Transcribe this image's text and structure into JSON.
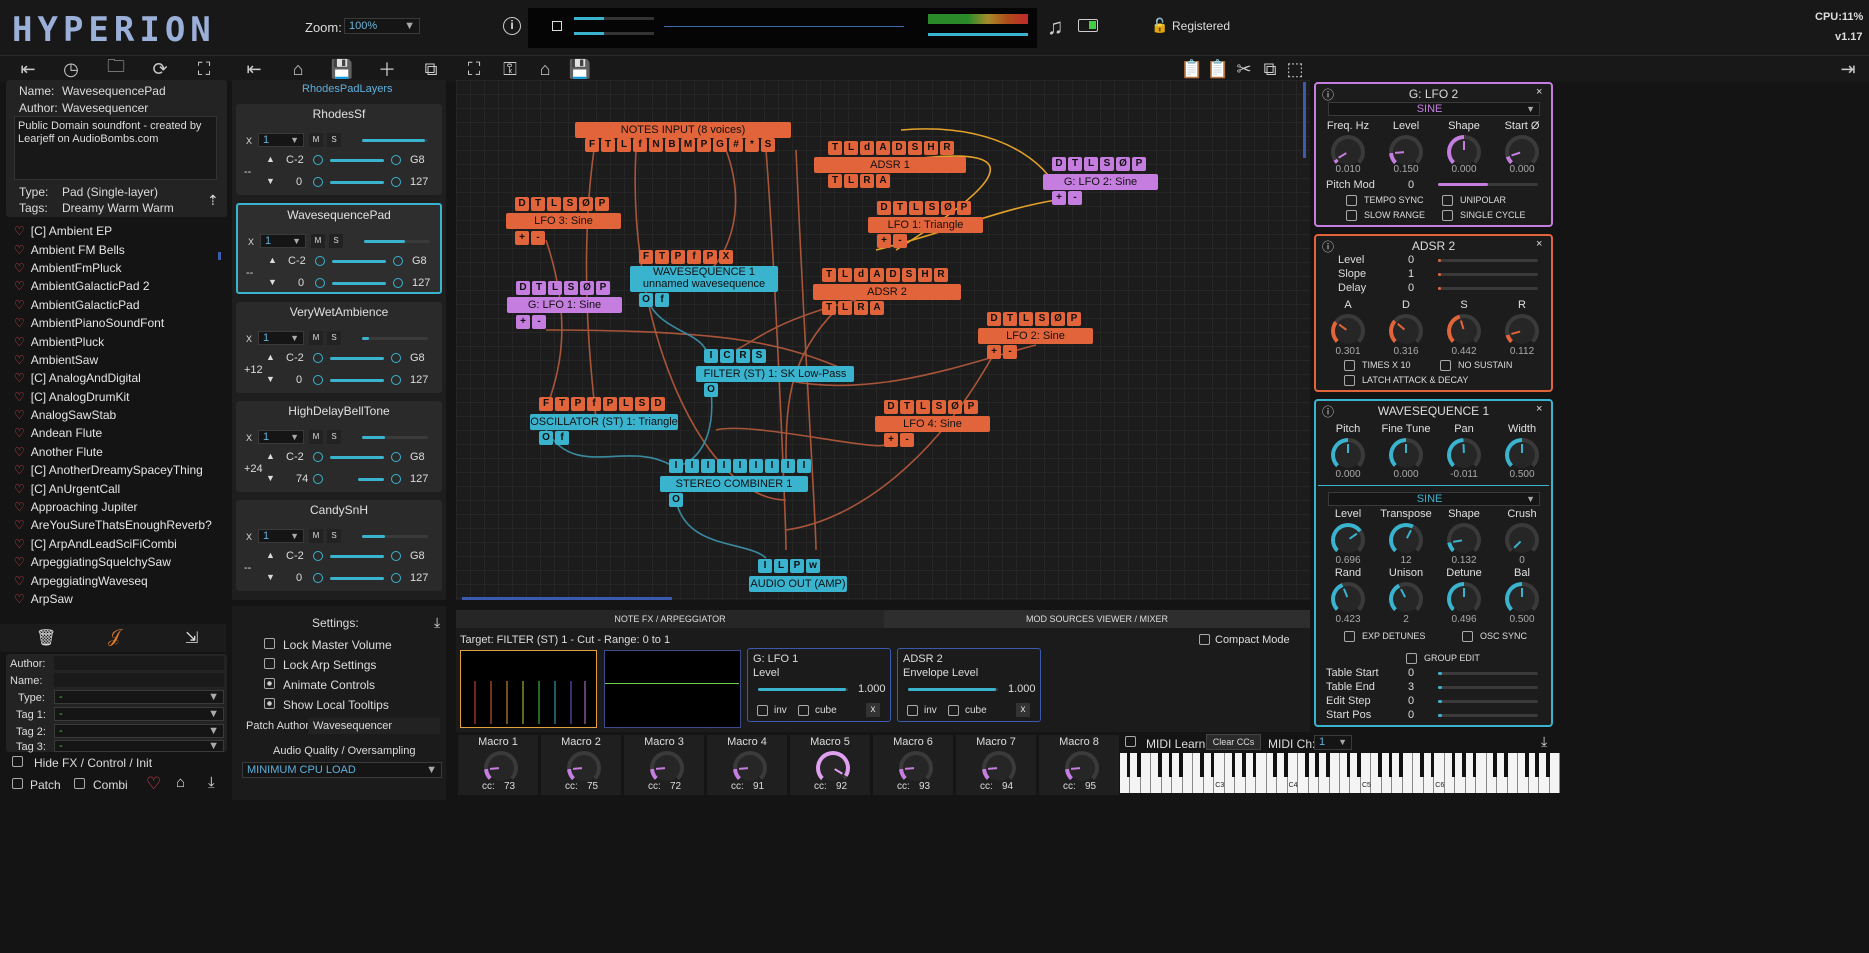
{
  "app": {
    "logo": "HYPERION",
    "zoom_label": "Zoom:",
    "zoom_value": "100%",
    "registered": "Registered",
    "cpu": "CPU:11%",
    "version": "v1.17"
  },
  "patch": {
    "name_label": "Name:",
    "name": "WavesequencePad",
    "author_label": "Author:",
    "author": "Wavesequencer",
    "description": "Public Domain soundfont - created by Learjeff on AudioBombs.com",
    "type_label": "Type:",
    "type": "Pad  (Single-layer)",
    "tags_label": "Tags:",
    "tags": "Dreamy Warm Warm"
  },
  "presets": [
    "[C] Ambient EP",
    "Ambient FM Bells",
    "AmbientFmPluck",
    "AmbientGalacticPad 2",
    "AmbientGalacticPad",
    "AmbientPianoSoundFont",
    "AmbientPluck",
    "AmbientSaw",
    "[C] AnalogAndDigital",
    "[C] AnalogDrumKit",
    "AnalogSawStab",
    "Andean Flute",
    "Another Flute",
    "[C] AnotherDreamySpaceyThing",
    "[C] AnUrgentCall",
    "Approaching Jupiter",
    "AreYouSureThatsEnoughReverb?",
    "[C] ArpAndLeadSciFiCombi",
    "ArpeggiatingSquelchySaw",
    "ArpeggiatingWaveseq",
    "ArpSaw"
  ],
  "filters": {
    "author": "Author:",
    "name": "Name:",
    "type": "Type:",
    "tag1": "Tag 1:",
    "tag2": "Tag 2:",
    "tag3": "Tag 3:",
    "dash": "-",
    "hide_fx": "Hide FX / Control / Init",
    "patch": "Patch",
    "combi": "Combi"
  },
  "layers": {
    "title": "RhodesPadLayers",
    "items": [
      {
        "name": "RhodesSf",
        "ch": "1",
        "lo": "C-2",
        "hi": "G8",
        "vlo": "0",
        "vhi": "127",
        "tr": "--",
        "m": "M",
        "s": "S",
        "x": "X"
      },
      {
        "name": "WavesequencePad",
        "ch": "1",
        "lo": "C-2",
        "hi": "G8",
        "vlo": "0",
        "vhi": "127",
        "tr": "--",
        "m": "M",
        "s": "S",
        "x": "X"
      },
      {
        "name": "VeryWetAmbience",
        "ch": "1",
        "lo": "C-2",
        "hi": "G8",
        "vlo": "0",
        "vhi": "127",
        "tr": "+12",
        "m": "M",
        "s": "S",
        "x": "X"
      },
      {
        "name": "HighDelayBellTone",
        "ch": "1",
        "lo": "C-2",
        "hi": "G8",
        "vlo": "74",
        "vhi": "127",
        "tr": "+24",
        "m": "M",
        "s": "S",
        "x": "X"
      },
      {
        "name": "CandySnH",
        "ch": "1",
        "lo": "C-2",
        "hi": "G8",
        "vlo": "0",
        "vhi": "127",
        "tr": "--",
        "m": "M",
        "s": "S",
        "x": "X"
      }
    ]
  },
  "settings": {
    "title": "Settings:",
    "lock_master": "Lock Master Volume",
    "lock_arp": "Lock Arp Settings",
    "animate": "Animate Controls",
    "tooltips": "Show Local Tooltips",
    "patch_author_label": "Patch Author:",
    "patch_author": "Wavesequencer",
    "quality_label": "Audio Quality / Oversampling",
    "quality": "MINIMUM CPU LOAD"
  },
  "graph": {
    "notes": "NOTES INPUT  (8 voices)",
    "notes_pins": [
      "F",
      "T",
      "L",
      "f",
      "N",
      "B",
      "M",
      "P",
      "G",
      "#",
      "*",
      "S"
    ],
    "adsr1": "ADSR 1",
    "adsr2": "ADSR 2",
    "adsr_pins": [
      "T",
      "L",
      "d",
      "A",
      "D",
      "S",
      "H",
      "R"
    ],
    "adsr_out": [
      "T",
      "L",
      "R",
      "A"
    ],
    "lfo_pins": [
      "D",
      "T",
      "L",
      "S",
      "Ø",
      "P"
    ],
    "lfo_out": [
      "+",
      "-"
    ],
    "lfo3": "LFO 3: Sine",
    "lfo1": "LFO 1: Triangle",
    "glfo2": "G: LFO 2: Sine",
    "glfo1": "G: LFO 1: Sine",
    "lfo2": "LFO 2: Sine",
    "lfo4": "LFO 4: Sine",
    "ws_pins": [
      "F",
      "T",
      "P",
      "f",
      "P",
      "X"
    ],
    "ws1": "WAVESEQUENCE 1",
    "ws1b": "unnamed wavesequence",
    "ws_out": [
      "O",
      "f"
    ],
    "filter_pins": [
      "I",
      "C",
      "R",
      "S"
    ],
    "filter": "FILTER (ST) 1: SK Low-Pass",
    "filter_out": [
      "O"
    ],
    "osc_pins": [
      "F",
      "T",
      "P",
      "f",
      "P",
      "L",
      "S",
      "D"
    ],
    "osc": "OSCILLATOR (ST) 1: Triangle",
    "osc_out": [
      "O",
      "f"
    ],
    "comb_pins": [
      "I",
      "I",
      "I",
      "I",
      "I",
      "I",
      "I",
      "I",
      "I"
    ],
    "comb": "STEREO COMBINER 1",
    "comb_out": [
      "O"
    ],
    "out_pins": [
      "I",
      "L",
      "P",
      "w"
    ],
    "out": "AUDIO OUT (AMP)"
  },
  "bottom": {
    "tab1": "NOTE FX / ARPEGGIATOR",
    "tab2": "MOD SOURCES VIEWER / MIXER",
    "target": "Target: FILTER (ST) 1 - Cut - Range: 0 to 1",
    "compact": "Compact Mode",
    "mod1_title": "G: LFO 1",
    "mod1_param": "Level",
    "mod1_val": "1.000",
    "mod2_title": "ADSR 2",
    "mod2_param": "Envelope Level",
    "mod2_val": "1.000",
    "inv": "inv",
    "cube": "cube",
    "x": "x"
  },
  "macros": [
    {
      "name": "Macro 1",
      "cc": "73"
    },
    {
      "name": "Macro 2",
      "cc": "75"
    },
    {
      "name": "Macro 3",
      "cc": "72"
    },
    {
      "name": "Macro 4",
      "cc": "91"
    },
    {
      "name": "Macro 5",
      "cc": "92"
    },
    {
      "name": "Macro 6",
      "cc": "93"
    },
    {
      "name": "Macro 7",
      "cc": "94"
    },
    {
      "name": "Macro 8",
      "cc": "95"
    }
  ],
  "cc_label": "cc:",
  "midi": {
    "learn": "MIDI Learn",
    "clear": "Clear CCs",
    "ch_label": "MIDI Ch:",
    "ch": "1",
    "keys": [
      "C3",
      "C4",
      "C5",
      "C6"
    ]
  },
  "lfo2panel": {
    "title": "G: LFO 2",
    "wave": "SINE",
    "labels": [
      "Freq. Hz",
      "Level",
      "Shape",
      "Start Ø"
    ],
    "values": [
      "0.010",
      "0.150",
      "0.000",
      "0.000"
    ],
    "pitch_mod": "Pitch Mod",
    "pitch_val": "0",
    "tempo": "TEMPO SYNC",
    "unipolar": "UNIPOLAR",
    "slow": "SLOW RANGE",
    "single": "SINGLE CYCLE"
  },
  "adsr2panel": {
    "title": "ADSR 2",
    "rows": [
      {
        "l": "Level",
        "v": "0"
      },
      {
        "l": "Slope",
        "v": "1"
      },
      {
        "l": "Delay",
        "v": "0"
      }
    ],
    "labels": [
      "A",
      "D",
      "S",
      "R"
    ],
    "values": [
      "0.301",
      "0.316",
      "0.442",
      "0.112"
    ],
    "times": "TIMES X 10",
    "nosustain": "NO SUSTAIN",
    "latch": "LATCH ATTACK & DECAY"
  },
  "wspanel": {
    "title": "WAVESEQUENCE 1",
    "labels1": [
      "Pitch",
      "Fine Tune",
      "Pan",
      "Width"
    ],
    "values1": [
      "0.000",
      "0.000",
      "-0.011",
      "0.500"
    ],
    "wave": "SINE",
    "labels2": [
      "Level",
      "Transpose",
      "Shape",
      "Crush"
    ],
    "values2": [
      "0.696",
      "12",
      "0.132",
      "0"
    ],
    "labels3": [
      "Rand",
      "Unison",
      "Detune",
      "Bal"
    ],
    "values3": [
      "0.423",
      "2",
      "0.496",
      "0.500"
    ],
    "exp": "EXP DETUNES",
    "osc": "OSC SYNC",
    "group": "GROUP EDIT",
    "rows": [
      {
        "l": "Table Start",
        "v": "0"
      },
      {
        "l": "Table End",
        "v": "3"
      },
      {
        "l": "Edit Step",
        "v": "0"
      },
      {
        "l": "Start Pos",
        "v": "0"
      }
    ]
  },
  "colors": {
    "orange": "#e2643a",
    "purple": "#c67de0",
    "blue": "#3ab3cf",
    "heart": "#e04455"
  }
}
